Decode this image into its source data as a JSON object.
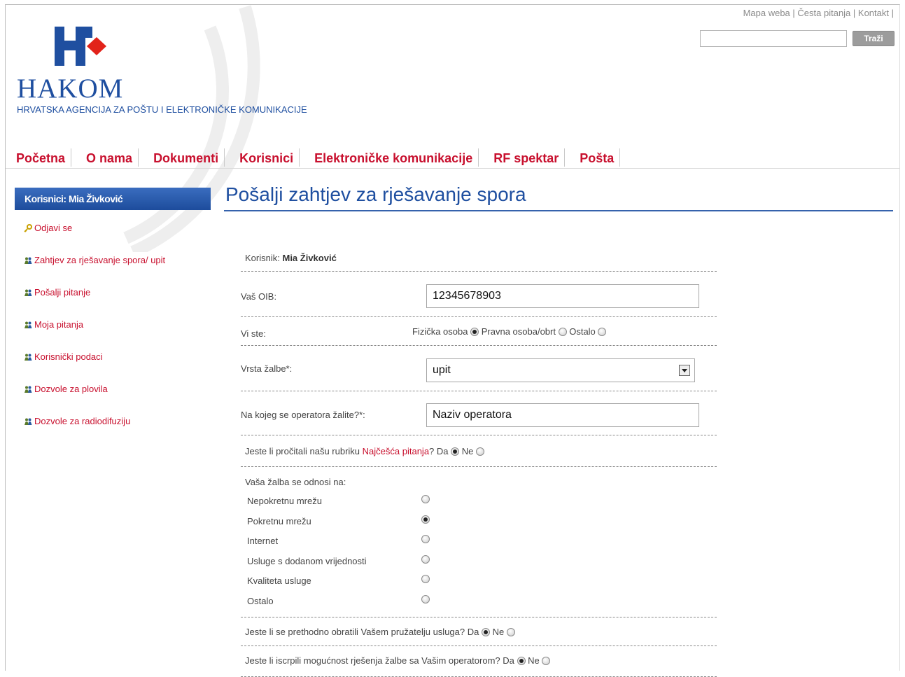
{
  "top": {
    "links": [
      "Mapa weba",
      "Česta pitanja",
      "Kontakt"
    ],
    "search_value": "",
    "search_button": "Traži"
  },
  "logo": {
    "name": "HAKOM",
    "subtitle": "HRVATSKA AGENCIJA ZA POŠTU I ELEKTRONIČKE KOMUNIKACIJE"
  },
  "nav": [
    "Početna",
    "O nama",
    "Dokumenti",
    "Korisnici",
    "Elektroničke komunikacije",
    "RF spektar",
    "Pošta"
  ],
  "sidebar": {
    "header": "Korisnici: Mia Živković",
    "items": [
      {
        "label": "Odjavi se",
        "icon": "key-icon"
      },
      {
        "label": "Zahtjev za rješavanje spora/ upit",
        "icon": "users-icon"
      },
      {
        "label": "Pošalji pitanje",
        "icon": "users-icon"
      },
      {
        "label": "Moja pitanja",
        "icon": "users-icon"
      },
      {
        "label": "Korisnički podaci",
        "icon": "users-icon"
      },
      {
        "label": "Dozvole za plovila",
        "icon": "users-icon"
      },
      {
        "label": "Dozvole za radiodifuziju",
        "icon": "users-icon"
      }
    ]
  },
  "main": {
    "title": "Pošalji zahtjev za rješavanje spora",
    "user_label": "Korisnik:",
    "user_value": "Mia Živković",
    "oib_label": "Vaš OIB:",
    "oib_value": "12345678903",
    "vi_ste_label": "Vi ste:",
    "vi_ste_options": [
      "Fizička osoba",
      "Pravna osoba/obrt",
      "Ostalo"
    ],
    "vrsta_label": "Vrsta žalbe*:",
    "vrsta_value": "upit",
    "operator_label": "Na kojeg se operatora žalite?*:",
    "operator_value": "Naziv operatora",
    "faq_q_prefix": "Jeste li pročitali našu rubriku",
    "faq_q_link": "Najčešća pitanja",
    "faq_q_suffix": "? Da",
    "no_label": "Ne",
    "odnosi_label": "Vaša žalba se odnosi na:",
    "odnosi_options": [
      "Nepokretnu mrežu",
      "Pokretnu mrežu",
      "Internet",
      "Usluge s dodanom vrijednosti",
      "Kvaliteta usluge",
      "Ostalo"
    ],
    "q2": "Jeste li se prethodno obratili Vašem pružatelju usluga? Da",
    "q3": "Jeste li iscrpili mogućnost rješenja žalbe sa Vašim operatorom? Da"
  }
}
